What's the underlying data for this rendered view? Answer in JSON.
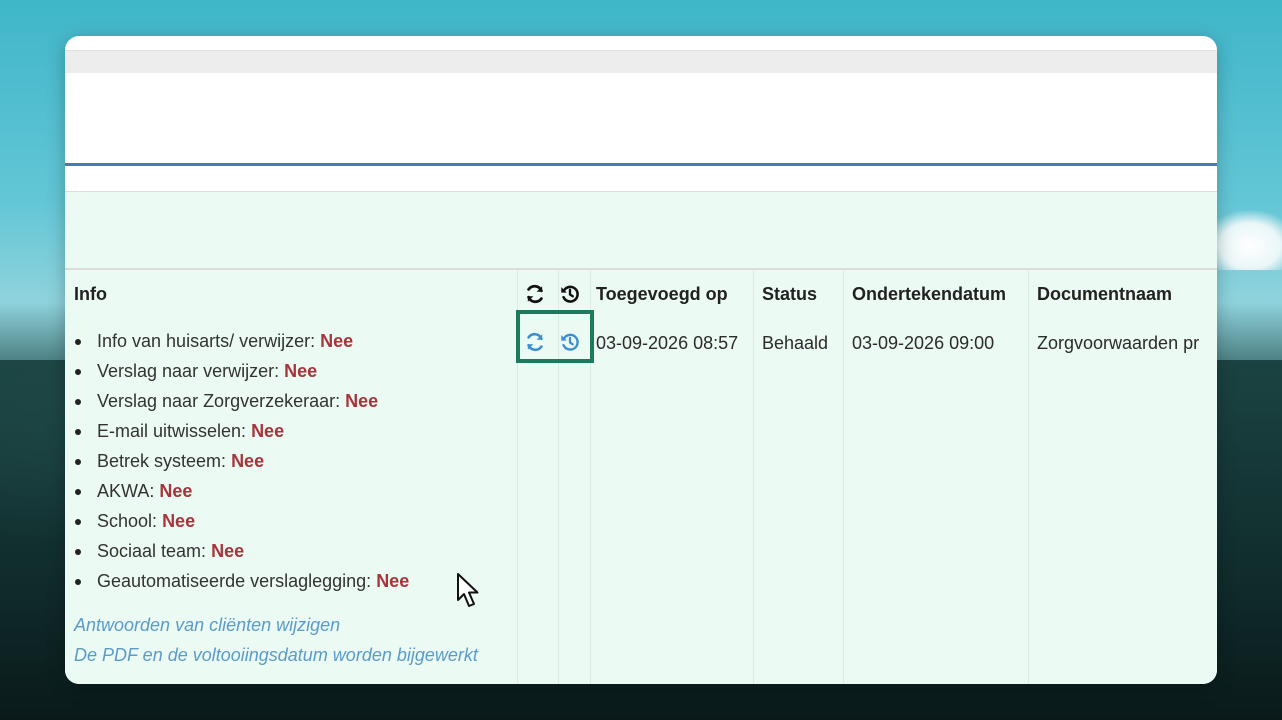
{
  "table": {
    "headers": {
      "info": "Info",
      "added_on": "Toegevoegd op",
      "status": "Status",
      "signed_date": "Ondertekendatum",
      "document_name": "Documentnaam"
    },
    "header_icons": [
      "refresh-icon",
      "history-icon"
    ],
    "row": {
      "action_icons": [
        "refresh-icon",
        "history-icon"
      ],
      "added_on": "03-09-2026 08:57",
      "status": "Behaald",
      "signed_date": "03-09-2026 09:00",
      "document_name": "Zorgvoorwaarden pr",
      "info_items": [
        {
          "label": "Info van huisarts/ verwijzer:",
          "value": "Nee"
        },
        {
          "label": "Verslag naar verwijzer:",
          "value": "Nee"
        },
        {
          "label": "Verslag naar Zorgverzekeraar:",
          "value": "Nee"
        },
        {
          "label": "E-mail uitwisselen:",
          "value": "Nee"
        },
        {
          "label": "Betrek systeem:",
          "value": "Nee"
        },
        {
          "label": "AKWA:",
          "value": "Nee"
        },
        {
          "label": "School:",
          "value": "Nee"
        },
        {
          "label": "Sociaal team:",
          "value": "Nee"
        },
        {
          "label": "Geautomatiseerde verslaglegging:",
          "value": "Nee"
        }
      ],
      "links": {
        "edit_answers": "Antwoorden van cliënten wijzigen",
        "pdf_update": "De PDF en de voltooiingsdatum worden bijgewerkt"
      }
    }
  },
  "colors": {
    "accent_blue": "#3f7eb3",
    "row_background": "#ebfaf3",
    "no_value": "#a8343b",
    "link": "#5b9bc9",
    "icon_blue": "#3b8fd0",
    "highlight_border": "#1c7a5e"
  }
}
